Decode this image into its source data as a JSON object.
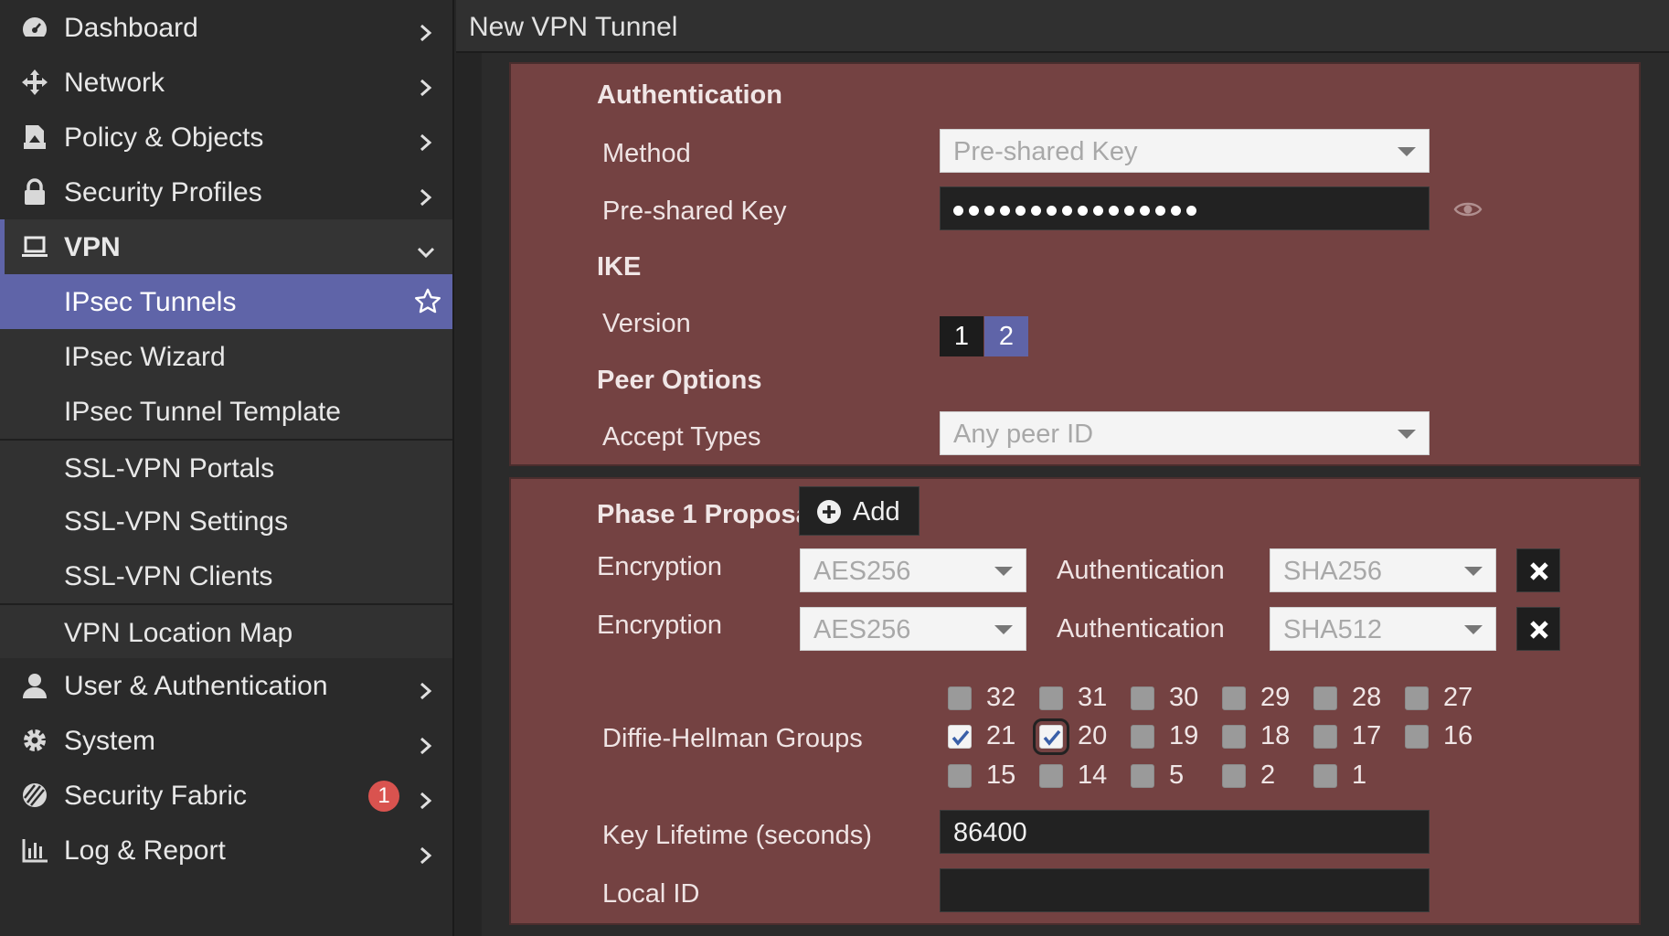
{
  "sidebar": {
    "items": [
      {
        "label": "Dashboard"
      },
      {
        "label": "Network"
      },
      {
        "label": "Policy & Objects"
      },
      {
        "label": "Security Profiles"
      },
      {
        "label": "VPN"
      },
      {
        "label": "User & Authentication"
      },
      {
        "label": "System"
      },
      {
        "label": "Security Fabric",
        "badge": "1"
      },
      {
        "label": "Log & Report"
      }
    ],
    "vpn_sub": [
      {
        "label": "IPsec Tunnels"
      },
      {
        "label": "IPsec Wizard"
      },
      {
        "label": "IPsec Tunnel Template"
      },
      {
        "label": "SSL-VPN Portals"
      },
      {
        "label": "SSL-VPN Settings"
      },
      {
        "label": "SSL-VPN Clients"
      },
      {
        "label": "VPN Location Map"
      }
    ]
  },
  "page": {
    "title": "New VPN Tunnel"
  },
  "auth": {
    "title": "Authentication",
    "method_label": "Method",
    "method_value": "Pre-shared Key",
    "psk_label": "Pre-shared Key",
    "ike_title": "IKE",
    "version_label": "Version",
    "version_options": [
      "1",
      "2"
    ],
    "version_selected": "2",
    "peer_title": "Peer Options",
    "accept_label": "Accept Types",
    "accept_value": "Any peer ID"
  },
  "phase1": {
    "title": "Phase 1 Proposal",
    "add_label": "Add",
    "proposals": [
      {
        "enc_label": "Encryption",
        "enc_value": "AES256",
        "auth_label": "Authentication",
        "auth_value": "SHA256"
      },
      {
        "enc_label": "Encryption",
        "enc_value": "AES256",
        "auth_label": "Authentication",
        "auth_value": "SHA512"
      }
    ],
    "dh_label": "Diffie-Hellman Groups",
    "dh_groups": [
      {
        "num": "32",
        "checked": false
      },
      {
        "num": "31",
        "checked": false
      },
      {
        "num": "30",
        "checked": false
      },
      {
        "num": "29",
        "checked": false
      },
      {
        "num": "28",
        "checked": false
      },
      {
        "num": "27",
        "checked": false
      },
      {
        "num": "21",
        "checked": true
      },
      {
        "num": "20",
        "checked": true
      },
      {
        "num": "19",
        "checked": false
      },
      {
        "num": "18",
        "checked": false
      },
      {
        "num": "17",
        "checked": false
      },
      {
        "num": "16",
        "checked": false
      },
      {
        "num": "15",
        "checked": false
      },
      {
        "num": "14",
        "checked": false
      },
      {
        "num": "5",
        "checked": false
      },
      {
        "num": "2",
        "checked": false
      },
      {
        "num": "1",
        "checked": false
      }
    ],
    "keylife_label": "Key Lifetime (seconds)",
    "keylife_value": "86400",
    "localid_label": "Local ID",
    "localid_value": ""
  },
  "colors": {
    "accent": "#5f64a8",
    "panel": "#744242",
    "badge": "#d9534f"
  }
}
